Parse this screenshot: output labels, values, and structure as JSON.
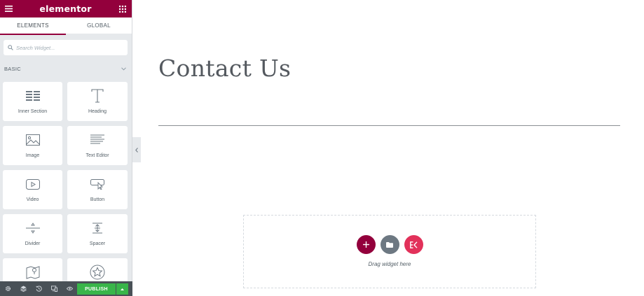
{
  "panel": {
    "title": "elementor",
    "tabs": [
      {
        "label": "ELEMENTS",
        "active": true
      },
      {
        "label": "GLOBAL",
        "active": false
      }
    ],
    "search_placeholder": "Search Widget...",
    "category_title": "BASIC",
    "widgets": [
      {
        "label": "Inner Section",
        "icon": "inner-section-icon"
      },
      {
        "label": "Heading",
        "icon": "heading-icon"
      },
      {
        "label": "Image",
        "icon": "image-icon"
      },
      {
        "label": "Text Editor",
        "icon": "text-editor-icon"
      },
      {
        "label": "Video",
        "icon": "video-icon"
      },
      {
        "label": "Button",
        "icon": "button-icon"
      },
      {
        "label": "Divider",
        "icon": "divider-icon"
      },
      {
        "label": "Spacer",
        "icon": "spacer-icon"
      },
      {
        "label": "",
        "icon": "google-maps-icon"
      },
      {
        "label": "",
        "icon": "star-icon"
      }
    ]
  },
  "footer": {
    "publish_label": "PUBLISH",
    "icons": [
      "gear-icon",
      "layers-icon",
      "history-icon",
      "responsive-icon",
      "eye-icon"
    ]
  },
  "canvas": {
    "heading": "Contact Us",
    "drop_text": "Drag widget here"
  },
  "colors": {
    "brand": "#93003c",
    "publish": "#39b54a",
    "add": "#93003c",
    "template": "#6d7882",
    "elementskit": "#e2315a"
  }
}
